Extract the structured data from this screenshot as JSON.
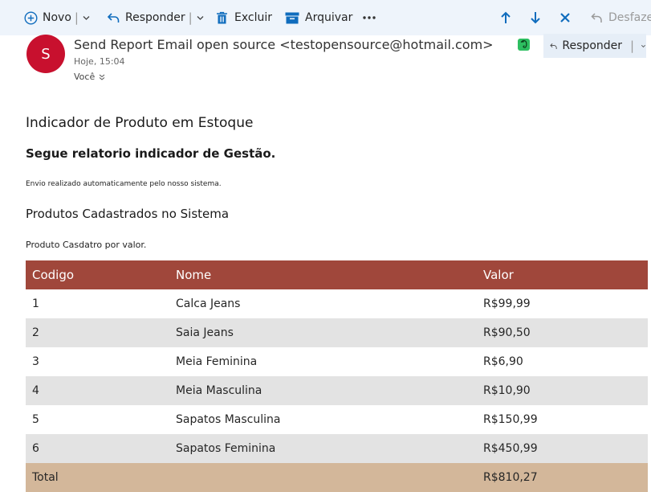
{
  "toolbar": {
    "novo": "Novo",
    "responder": "Responder",
    "excluir": "Excluir",
    "arquivar": "Arquivar",
    "desfazer": "Desfazer"
  },
  "email": {
    "avatar_letter": "S",
    "sender": "Send Report Email open source <testopensource@hotmail.com>",
    "time": "Hoje, 15:04",
    "to": "Você",
    "reply_label": "Responder"
  },
  "body": {
    "title": "Indicador de Produto em Estoque",
    "subtitle": "Segue relatorio indicador de Gestão.",
    "notice": "Envio realizado automaticamente pelo nosso sistema.",
    "section": "Produtos Cadastrados no Sistema",
    "note": "Produto Casdatro por valor."
  },
  "table": {
    "headers": [
      "Codigo",
      "Nome",
      "Valor"
    ],
    "rows": [
      [
        "1",
        "Calca Jeans",
        "R$99,99"
      ],
      [
        "2",
        "Saia Jeans",
        "R$90,50"
      ],
      [
        "3",
        "Meia Feminina",
        "R$6,90"
      ],
      [
        "4",
        "Meia Masculina",
        "R$10,90"
      ],
      [
        "5",
        "Sapatos Masculina",
        "R$150,99"
      ],
      [
        "6",
        "Sapatos Feminina",
        "R$450,99"
      ]
    ],
    "total": [
      "Total",
      "",
      "R$810,27"
    ]
  },
  "colors": {
    "header_bg": "#a0473b",
    "alt_row": "#e3e3e3",
    "total_bg": "#d3b79a",
    "avatar": "#c8102e",
    "accent": "#0f6cbd"
  }
}
